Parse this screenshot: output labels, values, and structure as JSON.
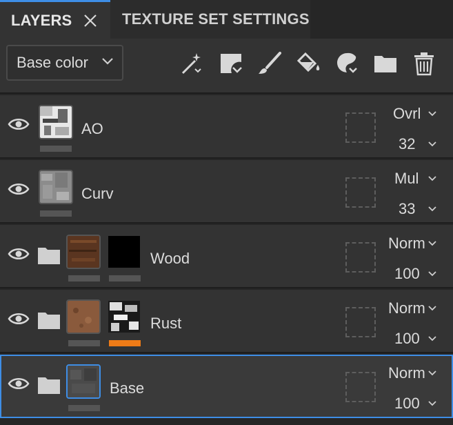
{
  "tabs": {
    "layers": "LAYERS",
    "texture_set": "TEXTURE SET SETTINGS"
  },
  "toolbar": {
    "channel": "Base color",
    "tools": [
      "add-effect-icon",
      "add-layer-icon",
      "paint-layer-icon",
      "fill-layer-icon",
      "add-mask-icon",
      "folder-icon",
      "trash-icon"
    ]
  },
  "layers": [
    {
      "name": "AO",
      "blend": "Ovrl",
      "opacity": "32",
      "has_folder": false,
      "selected": false
    },
    {
      "name": "Curv",
      "blend": "Mul",
      "opacity": "33",
      "has_folder": false,
      "selected": false
    },
    {
      "name": "Wood",
      "blend": "Norm",
      "opacity": "100",
      "has_folder": true,
      "selected": false
    },
    {
      "name": "Rust",
      "blend": "Norm",
      "opacity": "100",
      "has_folder": true,
      "selected": false
    },
    {
      "name": "Base",
      "blend": "Norm",
      "opacity": "100",
      "has_folder": true,
      "selected": true
    }
  ],
  "colors": {
    "accent": "#3e8ee6",
    "orange": "#ee7b17",
    "panel": "#333333"
  }
}
